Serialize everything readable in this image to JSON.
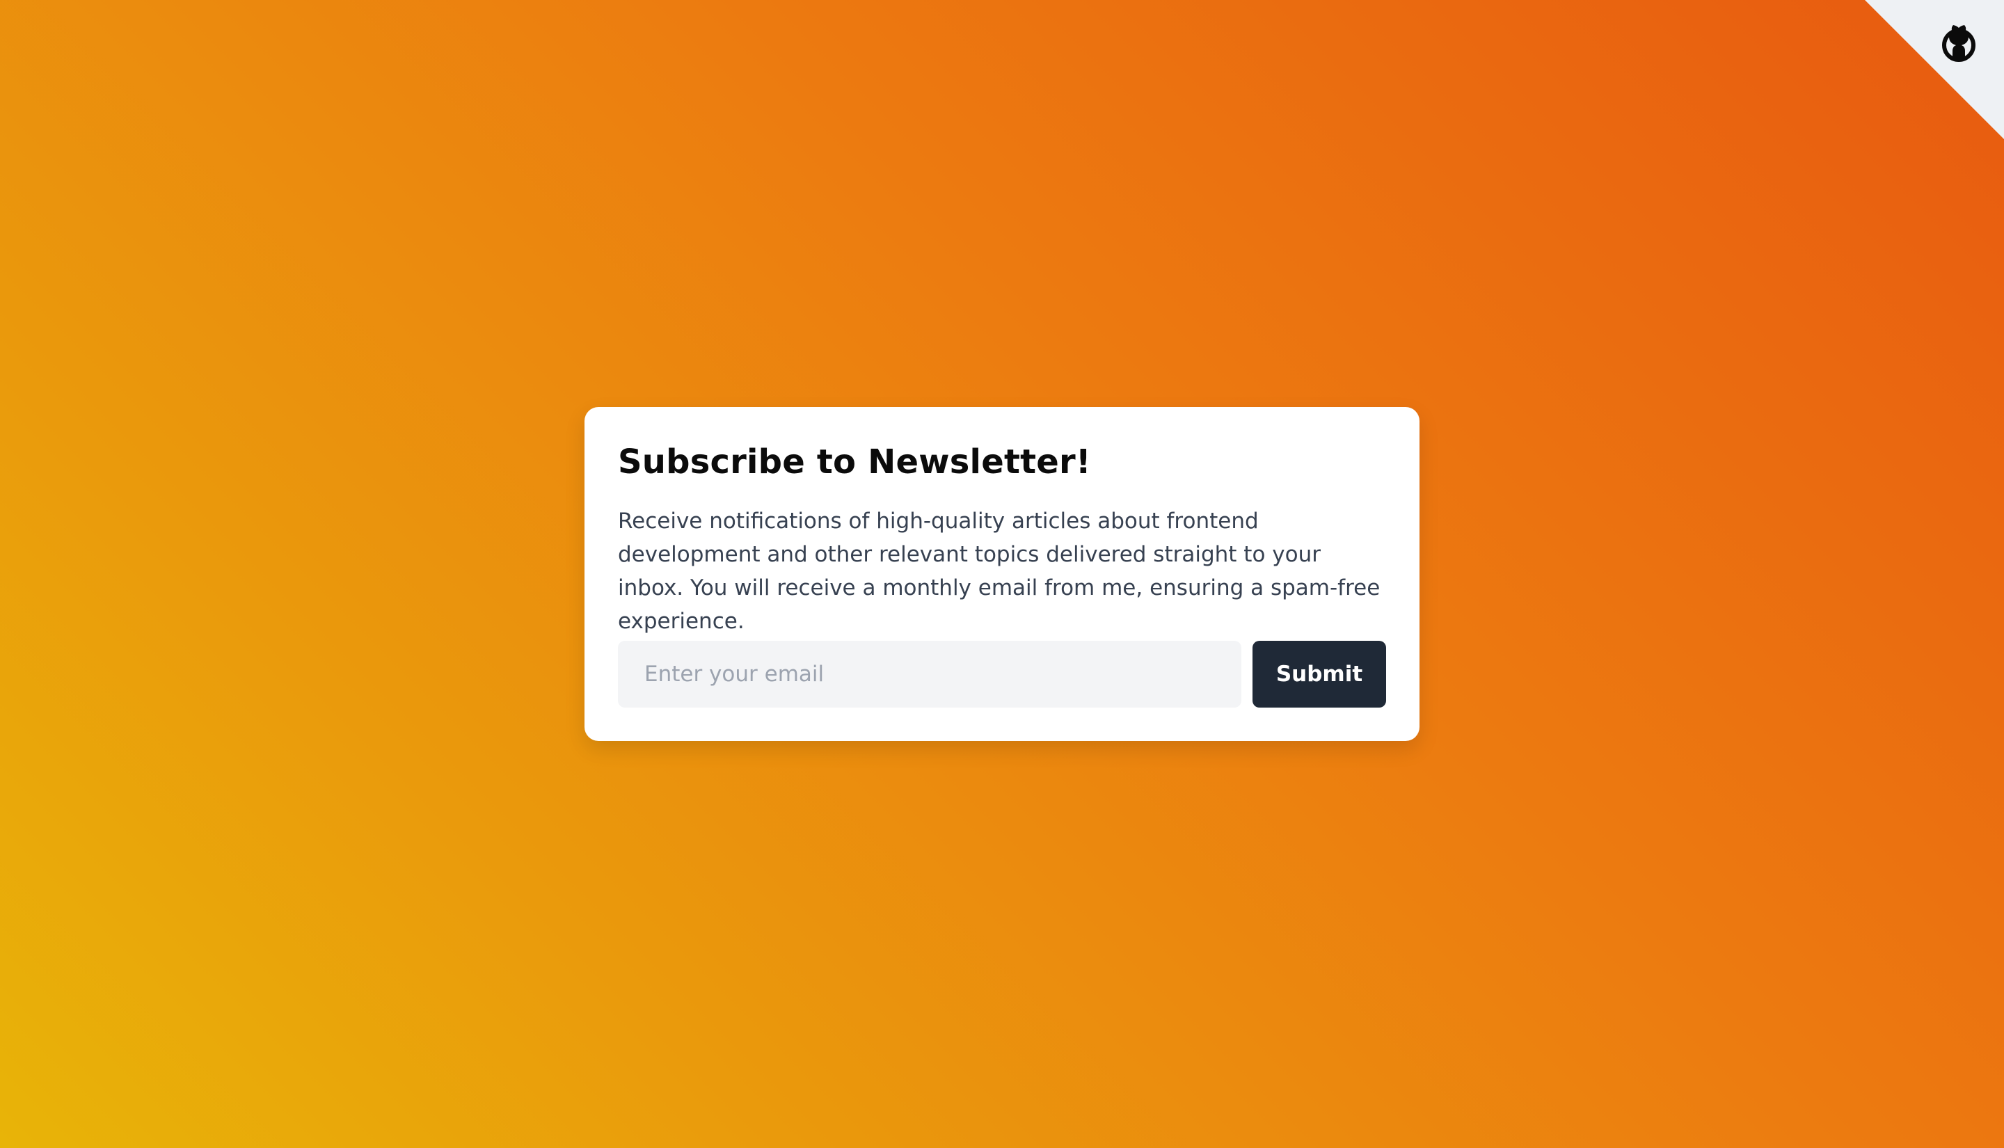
{
  "newsletter": {
    "title": "Subscribe to Newsletter!",
    "description": "Receive notifications of high-quality articles about frontend development and other relevant topics delivered straight to your inbox. You will receive a monthly email from me, ensuring a spam-free experience.",
    "email_placeholder": "Enter your email",
    "email_value": "",
    "submit_label": "Submit"
  },
  "corner": {
    "icon": "github-icon"
  },
  "colors": {
    "background_top_right": "#e85a10",
    "background_bottom_left": "#e8b408",
    "card": "#ffffff",
    "input_bg": "#f3f4f6",
    "button_bg": "#1f2937"
  }
}
